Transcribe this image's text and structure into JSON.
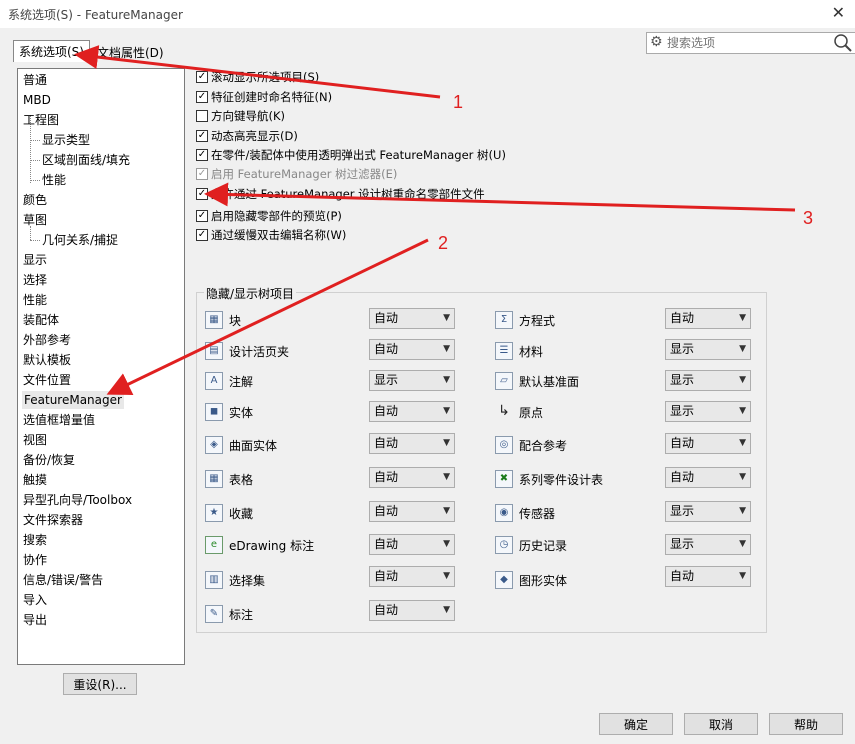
{
  "window": {
    "title": "系统选项(S) - FeatureManager",
    "close": "✕"
  },
  "tabs": [
    {
      "label": "系统选项(S)"
    },
    {
      "label": "文档属性(D)"
    }
  ],
  "search": {
    "placeholder": "搜索选项"
  },
  "nav": [
    {
      "label": "普通"
    },
    {
      "label": "MBD"
    },
    {
      "label": "工程图"
    },
    {
      "label": "显示类型"
    },
    {
      "label": "区域剖面线/填充"
    },
    {
      "label": "性能"
    },
    {
      "label": "颜色"
    },
    {
      "label": "草图"
    },
    {
      "label": "几何关系/捕捉"
    },
    {
      "label": "显示"
    },
    {
      "label": "选择"
    },
    {
      "label": "性能"
    },
    {
      "label": "装配体"
    },
    {
      "label": "外部参考"
    },
    {
      "label": "默认模板"
    },
    {
      "label": "文件位置"
    },
    {
      "label": "FeatureManager"
    },
    {
      "label": "选值框增量值"
    },
    {
      "label": "视图"
    },
    {
      "label": "备份/恢复"
    },
    {
      "label": "触摸"
    },
    {
      "label": "异型孔向导/Toolbox"
    },
    {
      "label": "文件探索器"
    },
    {
      "label": "搜索"
    },
    {
      "label": "协作"
    },
    {
      "label": "信息/错误/警告"
    },
    {
      "label": "导入"
    },
    {
      "label": "导出"
    }
  ],
  "reset_label": "重设(R)...",
  "options": [
    {
      "label": "滚动显示所选项目(S)",
      "checked": true,
      "disabled": false
    },
    {
      "label": "特征创建时命名特征(N)",
      "checked": true,
      "disabled": false
    },
    {
      "label": "方向键导航(K)",
      "checked": false,
      "disabled": false
    },
    {
      "label": "动态高亮显示(D)",
      "checked": true,
      "disabled": false
    },
    {
      "label": "在零件/装配体中使用透明弹出式 FeatureManager 树(U)",
      "checked": true,
      "disabled": false
    },
    {
      "label": "启用 FeatureManager 树过滤器(E)",
      "checked": true,
      "disabled": true
    },
    {
      "label": "允许通过 FeatureManager 设计树重命名零部件文件",
      "checked": true,
      "disabled": false
    },
    {
      "label": "启用隐藏零部件的预览(P)",
      "checked": true,
      "disabled": false
    },
    {
      "label": "通过缓慢双击编辑名称(W)",
      "checked": true,
      "disabled": false
    }
  ],
  "group_title": "隐藏/显示树项目",
  "tree_items_left": [
    {
      "label": "块",
      "value": "自动",
      "icon": "block-icon"
    },
    {
      "label": "设计活页夹",
      "value": "自动",
      "icon": "binder-icon"
    },
    {
      "label": "注解",
      "value": "显示",
      "icon": "annotation-icon"
    },
    {
      "label": "实体",
      "value": "自动",
      "icon": "solid-body-icon"
    },
    {
      "label": "曲面实体",
      "value": "自动",
      "icon": "surface-body-icon"
    },
    {
      "label": "表格",
      "value": "自动",
      "icon": "table-icon"
    },
    {
      "label": "收藏",
      "value": "自动",
      "icon": "favorite-icon"
    },
    {
      "label": "eDrawing 标注",
      "value": "自动",
      "icon": "edrawing-icon"
    },
    {
      "label": "选择集",
      "value": "自动",
      "icon": "selection-set-icon"
    },
    {
      "label": "标注",
      "value": "自动",
      "icon": "markup-icon"
    }
  ],
  "tree_items_right": [
    {
      "label": "方程式",
      "value": "自动",
      "icon": "equation-icon"
    },
    {
      "label": "材料",
      "value": "显示",
      "icon": "material-icon"
    },
    {
      "label": "默认基准面",
      "value": "显示",
      "icon": "plane-icon"
    },
    {
      "label": "原点",
      "value": "显示",
      "icon": "origin-icon"
    },
    {
      "label": "配合参考",
      "value": "自动",
      "icon": "mate-reference-icon"
    },
    {
      "label": "系列零件设计表",
      "value": "自动",
      "icon": "design-table-icon"
    },
    {
      "label": "传感器",
      "value": "显示",
      "icon": "sensor-icon"
    },
    {
      "label": "历史记录",
      "value": "显示",
      "icon": "history-icon"
    },
    {
      "label": "图形实体",
      "value": "自动",
      "icon": "graphics-body-icon"
    }
  ],
  "buttons": {
    "ok": "确定",
    "cancel": "取消",
    "help": "帮助"
  },
  "annotations": [
    "1",
    "2",
    "3"
  ],
  "colors": {
    "arrow": "#e02020",
    "selected": "#e8e8e8"
  }
}
